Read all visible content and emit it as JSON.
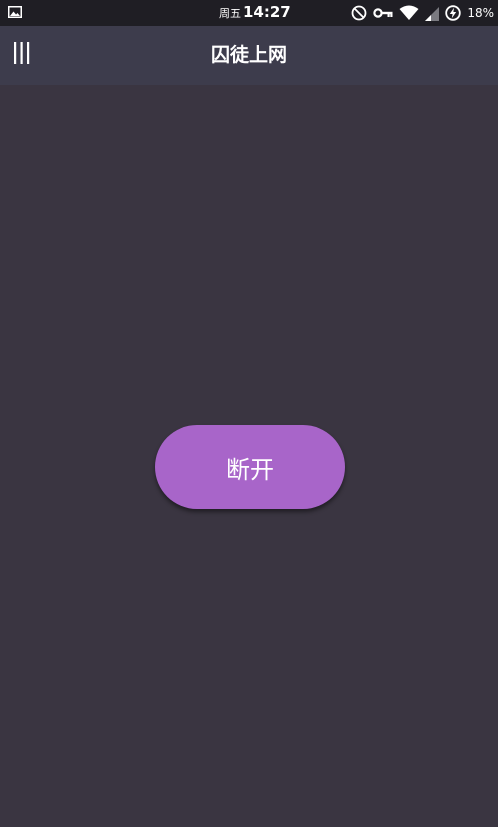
{
  "status_bar": {
    "day": "周五",
    "time": "14:27",
    "battery": "18%",
    "icons": [
      "image-icon",
      "do-not-disturb-icon",
      "vpn-key-icon",
      "wifi-icon",
      "signal-icon",
      "battery-charging-icon"
    ]
  },
  "app_bar": {
    "title": "囚徒上网",
    "menu_icon": "menu-icon"
  },
  "main": {
    "disconnect_label": "断开"
  },
  "colors": {
    "background": "#3a3541",
    "app_bar": "#3d3c4c",
    "status_bar": "#1f1e24",
    "button": "#a865c9",
    "text": "#ffffff"
  }
}
